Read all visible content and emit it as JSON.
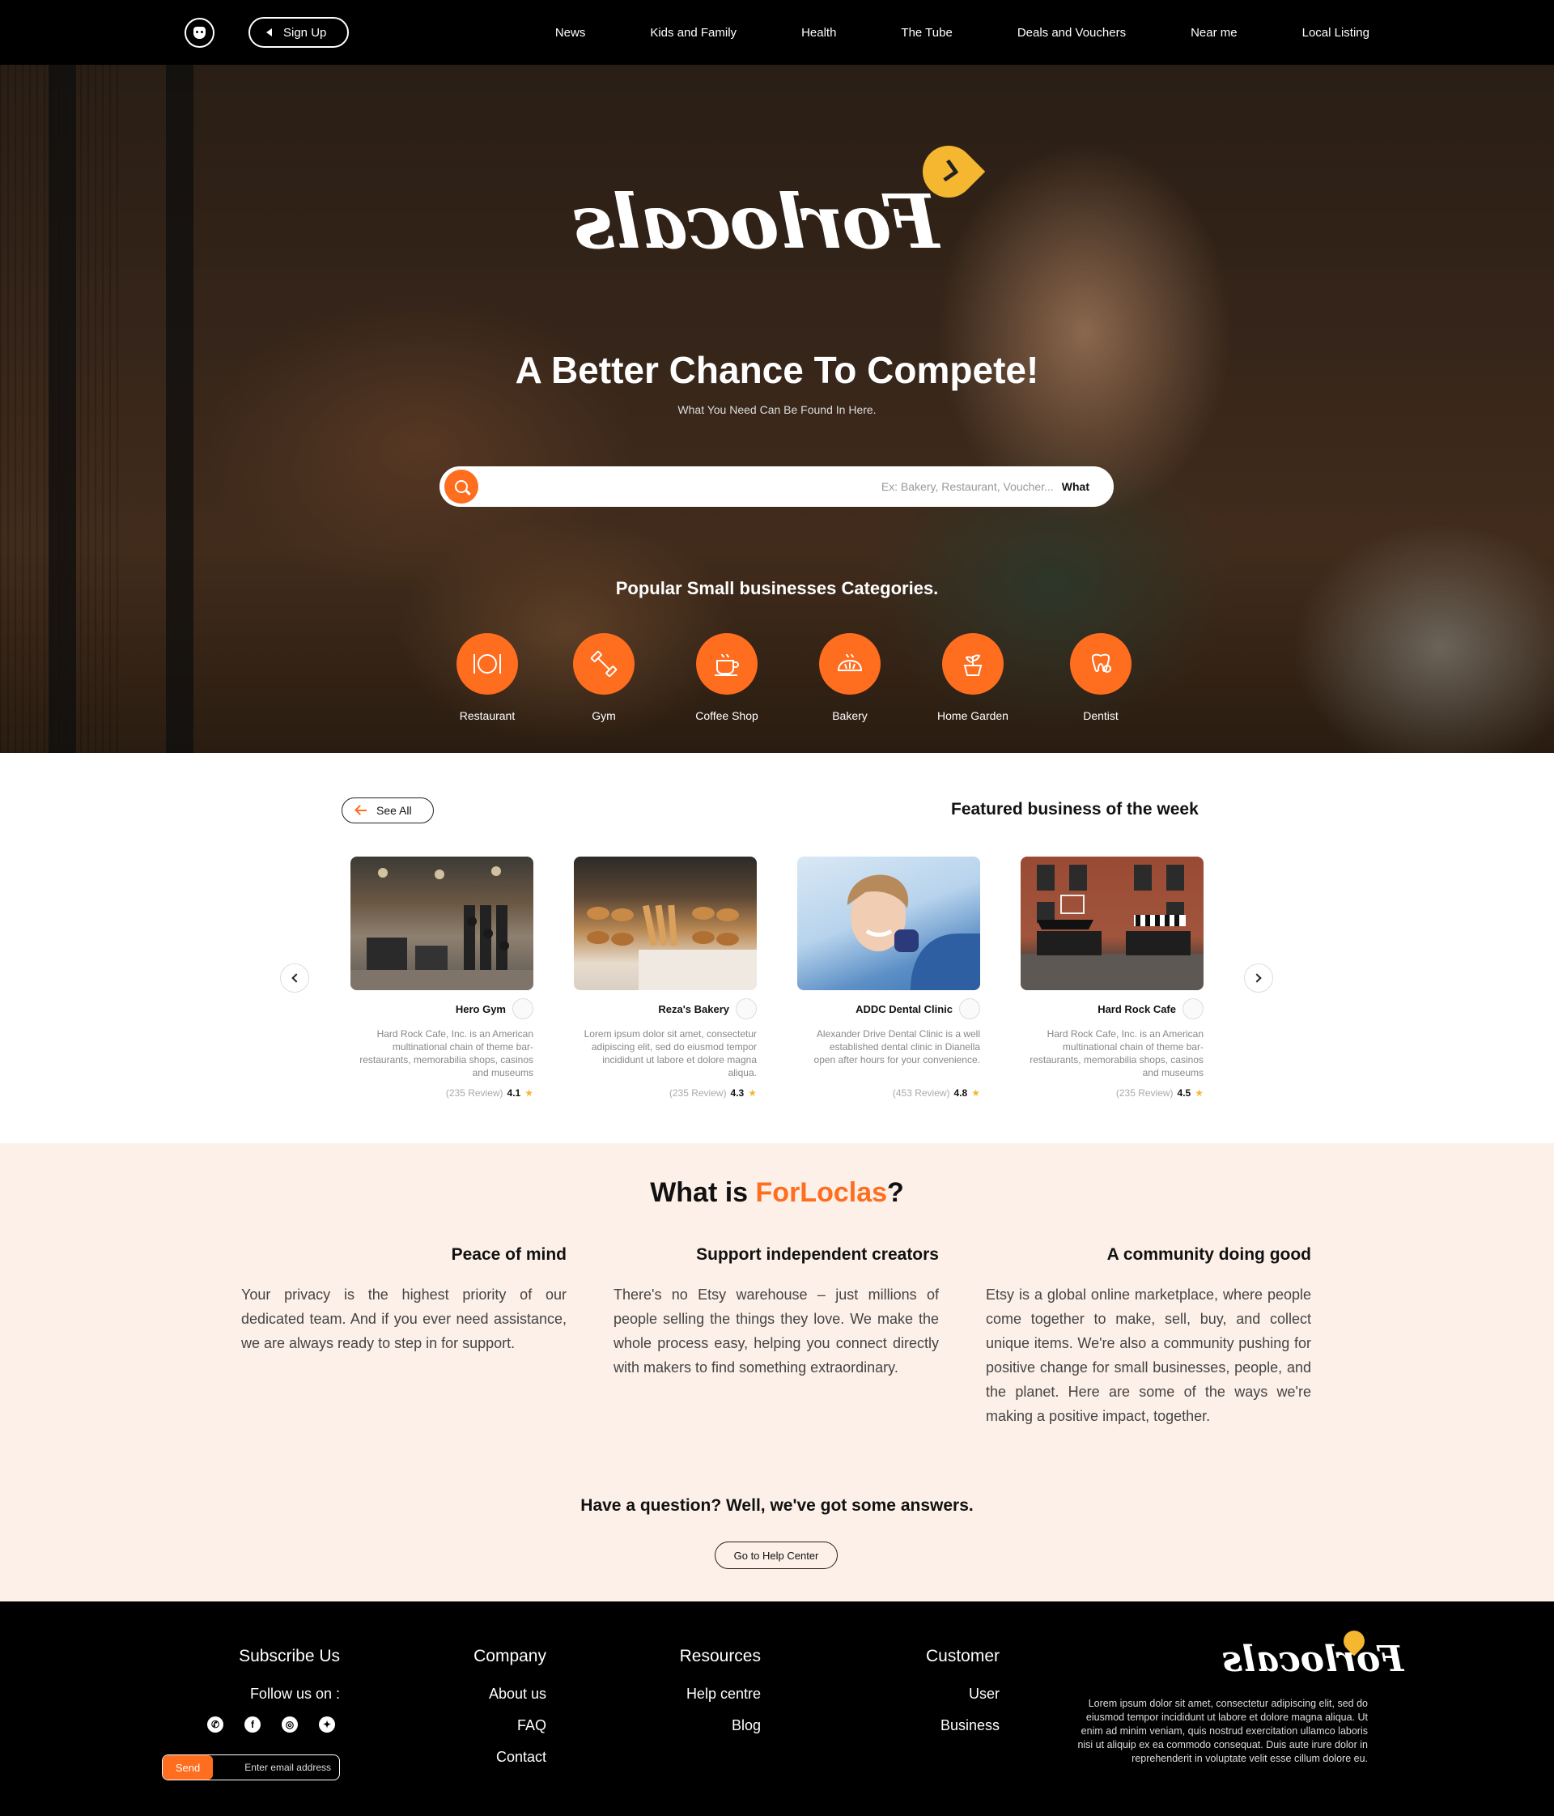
{
  "nav": {
    "signup_label": "Sign Up",
    "links": [
      "News",
      "Kids and Family",
      "Health",
      "The Tube",
      "Deals and Vouchers",
      "Near me",
      "Local Listing"
    ]
  },
  "hero": {
    "logo_text": "Forlocals",
    "title": "A Better Chance To Compete!",
    "subtitle": "What You Need Can Be Found In Here.",
    "search_label": "What",
    "search_placeholder": "Ex: Bakery, Restaurant, Voucher...",
    "categories_title": "Popular Small businesses Categories.",
    "categories": [
      "Restaurant",
      "Gym",
      "Coffee Shop",
      "Bakery",
      "Home Garden",
      "Dentist"
    ]
  },
  "featured": {
    "title": "Featured business of the week",
    "see_all": "See All",
    "cards": [
      {
        "name": "Hero Gym",
        "desc": "Hard Rock Cafe, Inc. is an American multinational chain of theme bar-restaurants, memorabilia shops, casinos and museums",
        "rating": "4.1",
        "reviews": "(235 Review)"
      },
      {
        "name": "Reza's Bakery",
        "desc": "Lorem ipsum dolor sit amet, consectetur adipiscing elit, sed do eiusmod tempor incididunt ut labore et dolore magna aliqua.",
        "rating": "4.3",
        "reviews": "(235 Review)"
      },
      {
        "name": "ADDC Dental Clinic",
        "desc": "Alexander Drive Dental Clinic is a well established dental clinic in Dianella open after hours for your convenience.",
        "rating": "4.8",
        "reviews": "(453 Review)"
      },
      {
        "name": "Hard Rock Cafe",
        "desc": "Hard Rock Cafe, Inc. is an American multinational chain of theme bar-restaurants, memorabilia shops, casinos and museums",
        "rating": "4.5",
        "reviews": "(235 Review)"
      }
    ]
  },
  "whatis": {
    "title_prefix": "What is ",
    "title_brand": "ForLoclas",
    "title_suffix": "?",
    "columns": [
      {
        "heading": "Peace of mind",
        "text": "Your privacy is the highest priority of our dedicated team. And if you ever need assistance, we are always ready to step in for support."
      },
      {
        "heading": "Support independent creators",
        "text": "There's no Etsy warehouse – just millions of people selling the things they love. We make the whole process easy, helping you connect directly with makers to find something extraordinary."
      },
      {
        "heading": "A community doing good",
        "text": "Etsy is a global online marketplace, where people come together to make, sell, buy, and collect unique items. We're also a community pushing for positive change for small businesses, people, and the planet. Here are some of the ways we're making a positive impact, together."
      }
    ],
    "question": "Have a question? Well, we've got some answers.",
    "help_button": "Go to Help Center"
  },
  "footer": {
    "logo_text": "Forlocals",
    "description": "Lorem ipsum dolor sit amet, consectetur adipiscing elit, sed do eiusmod tempor incididunt ut labore et dolore magna aliqua. Ut enim ad minim veniam, quis nostrud exercitation ullamco laboris nisi ut aliquip ex ea commodo consequat. Duis aute irure dolor in reprehenderit in voluptate velit esse cillum dolore eu.",
    "customer": {
      "title": "Customer",
      "links": [
        "User",
        "Business"
      ]
    },
    "resources": {
      "title": "Resources",
      "links": [
        "Help centre",
        "Blog"
      ]
    },
    "company": {
      "title": "Company",
      "links": [
        "About us",
        "FAQ",
        "Contact"
      ]
    },
    "subscribe": {
      "title": "Subscribe Us",
      "follow": "Follow us on :",
      "placeholder": "Enter email address",
      "send": "Send"
    }
  },
  "colors": {
    "accent": "#ff6d1f",
    "pin": "#f5b630",
    "cream": "#fdf0e8"
  }
}
